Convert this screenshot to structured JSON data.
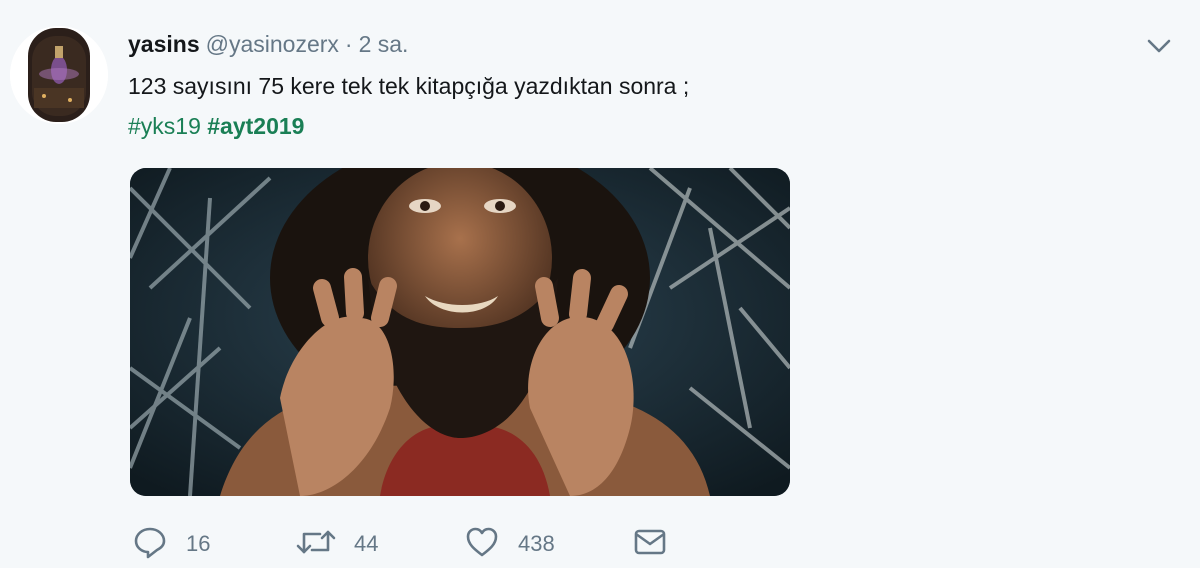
{
  "tweet": {
    "display_name": "yasins",
    "handle": "@yasinozerx",
    "separator": "·",
    "time": "2 sa.",
    "text": "123 sayısını 75 kere tek tek kitapçığa yazdıktan sonra ;",
    "hashtags": [
      "#yks19",
      "#ayt2019"
    ],
    "media_icon": "gif-image"
  },
  "actions": {
    "reply_count": "16",
    "retweet_count": "44",
    "like_count": "438"
  },
  "icons": {
    "caret": "chevron-down-icon",
    "reply": "speech-bubble-icon",
    "retweet": "retweet-icon",
    "like": "heart-icon",
    "dm": "envelope-icon"
  },
  "colors": {
    "background": "#f5f8fa",
    "hashtag": "#1a7f55",
    "secondary_text": "#657786"
  }
}
